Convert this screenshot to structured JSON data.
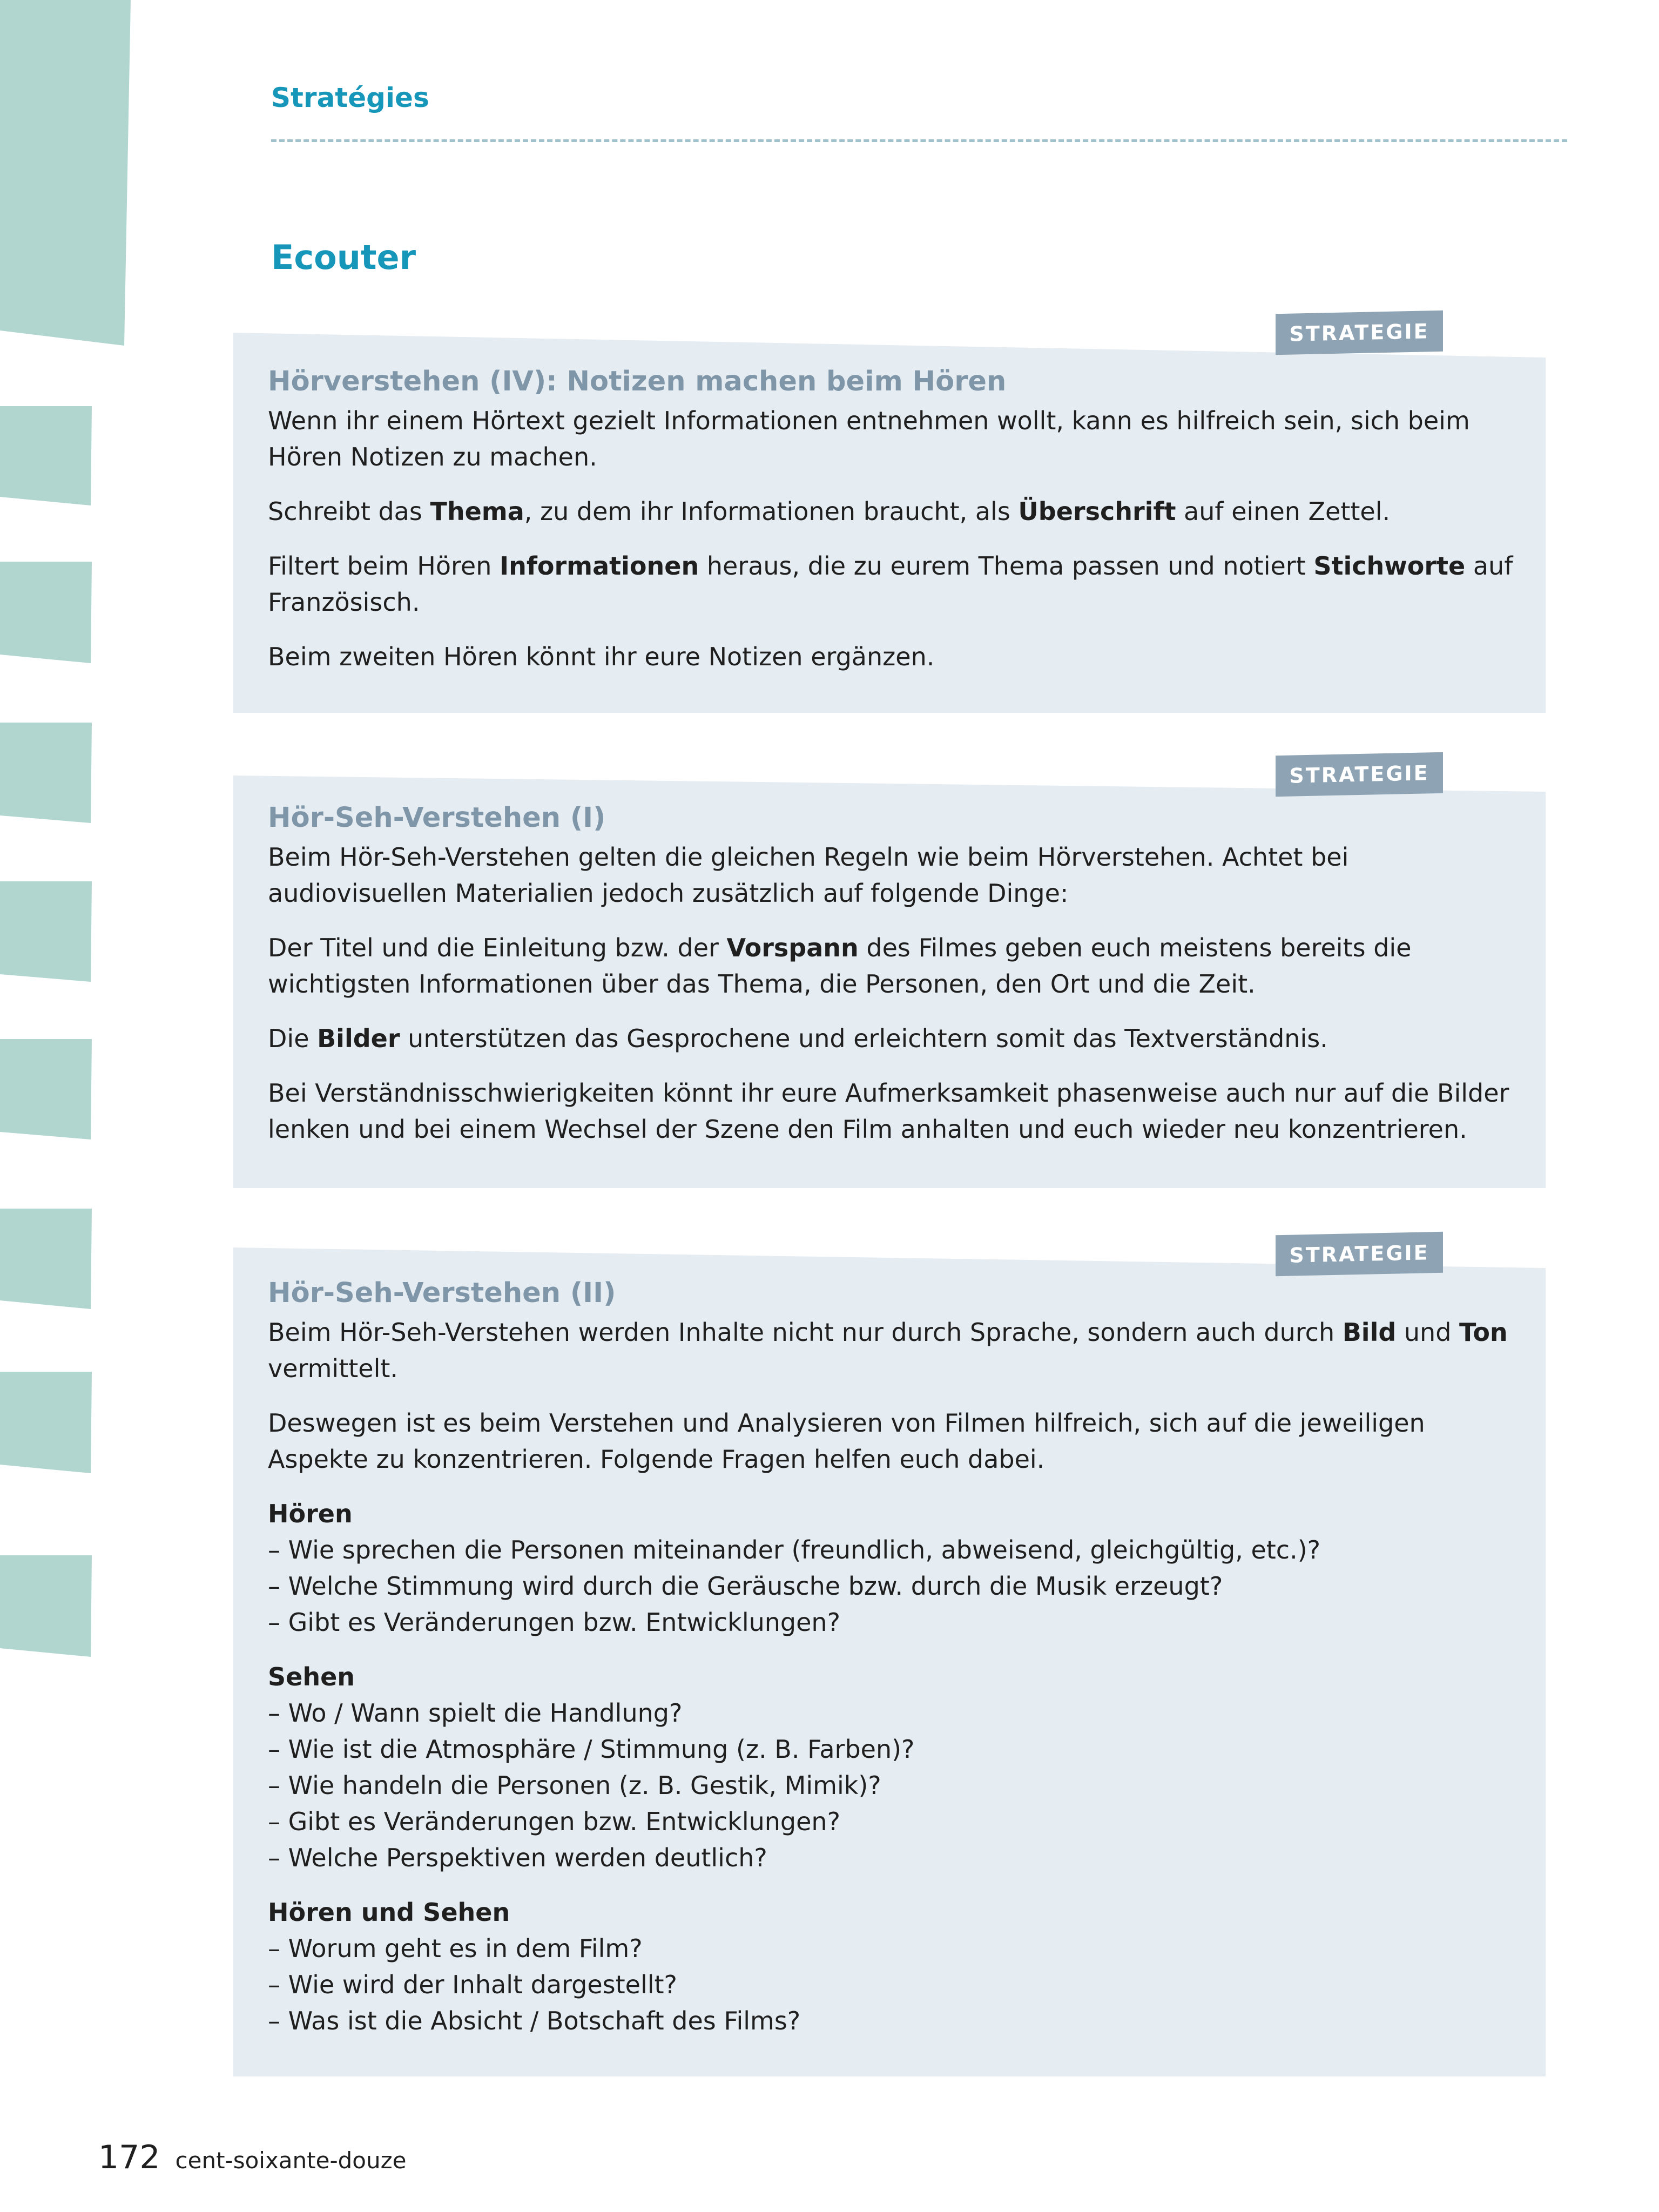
{
  "header": {
    "section": "Stratégies",
    "title": "Ecouter"
  },
  "boxes": [
    {
      "tag": "STRATEGIE",
      "heading": "Hörverstehen (IV): Notizen machen beim Hören",
      "p1": "Wenn ihr einem Hörtext gezielt Informationen entnehmen wollt, kann es hilfreich sein, sich beim Hören Notizen zu machen.",
      "p2": {
        "a": "Schreibt das ",
        "b1": "Thema",
        "c": ", zu dem ihr Informationen braucht, als ",
        "b2": "Überschrift",
        "d": " auf einen Zettel."
      },
      "p3": {
        "a": "Filtert beim Hören ",
        "b1": "Informationen",
        "c": " heraus, die zu eurem Thema passen und notiert ",
        "b2": "Stichworte",
        "d": " auf Französisch."
      },
      "p4": "Beim zweiten Hören könnt ihr eure Notizen ergänzen."
    },
    {
      "tag": "STRATEGIE",
      "heading": "Hör-Seh-Verstehen (I)",
      "p1": "Beim Hör-Seh-Verstehen gelten die gleichen Regeln wie beim Hörverstehen. Achtet bei audiovisuellen Materialien jedoch zusätzlich auf folgende Dinge:",
      "p2": {
        "a": "Der Titel und die Einleitung bzw. der ",
        "b1": "Vorspann",
        "c": " des Filmes geben euch meistens bereits die wichtigsten Informationen über das Thema, die Personen, den Ort und die Zeit."
      },
      "p3": {
        "a": "Die ",
        "b1": "Bilder",
        "c": " unterstützen das Gesprochene und erleichtern somit das Textverständnis."
      },
      "p4": "Bei Verständnisschwierigkeiten könnt ihr eure Aufmerksamkeit phasenweise auch nur auf die Bilder lenken und bei einem Wechsel der Szene den Film anhalten und euch wieder neu konzentrieren."
    },
    {
      "tag": "STRATEGIE",
      "heading": "Hör-Seh-Verstehen (II)",
      "p1": {
        "a": "Beim Hör-Seh-Verstehen werden Inhalte nicht nur durch Sprache, sondern auch durch ",
        "b1": "Bild",
        "c": " und ",
        "b2": "Ton",
        "d": " vermittelt."
      },
      "p2": "Deswegen ist es beim Verstehen und Analysieren von Filmen hilfreich, sich auf die jeweiligen Aspekte zu konzentrieren. Folgende Fragen helfen euch dabei.",
      "groups": [
        {
          "title": "Hören",
          "items": [
            "Wie sprechen die Personen miteinander (freundlich, abweisend, gleichgültig, etc.)?",
            "Welche Stimmung wird durch die Geräusche bzw. durch die Musik erzeugt?",
            "Gibt es Veränderungen bzw. Entwicklungen?"
          ]
        },
        {
          "title": "Sehen",
          "items": [
            "Wo / Wann spielt die Handlung?",
            "Wie ist die Atmosphäre / Stimmung (z. B. Farben)?",
            "Wie handeln die Personen (z. B. Gestik, Mimik)?",
            "Gibt es Veränderungen bzw. Entwicklungen?",
            "Welche Perspektiven werden deutlich?"
          ]
        },
        {
          "title": "Hören und Sehen",
          "items": [
            "Worum geht es in dem Film?",
            "Wie wird der Inhalt dargestellt?",
            "Was ist die Absicht / Botschaft des Films?"
          ]
        }
      ]
    }
  ],
  "footer": {
    "page_number": "172",
    "page_words": "cent-soixante-douze"
  },
  "colors": {
    "accent": "#1696b9",
    "box_bg": "#e5ecf2",
    "tag_bg": "#8ea4b4",
    "heading_grey": "#7f96a8",
    "side_tabs": "#b1d6cf"
  }
}
